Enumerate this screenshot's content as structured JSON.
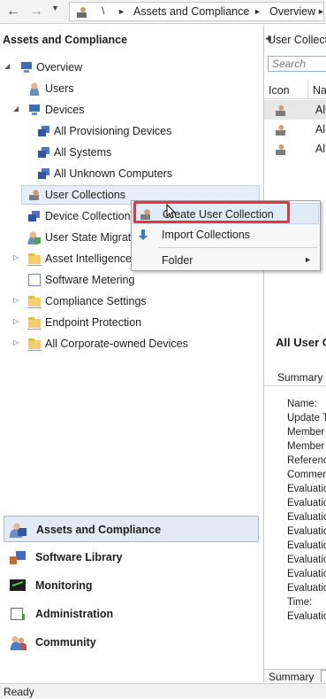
{
  "address_bar": {
    "back_icon": "back-arrow-icon",
    "forward_icon": "forward-arrow-icon",
    "root_sep": "\\",
    "crumb1": "Assets and Compliance",
    "crumb2": "Overview",
    "arrow": "►"
  },
  "left_pane": {
    "title": "Assets and Compliance",
    "tree": {
      "overview": "Overview",
      "users": "Users",
      "devices": "Devices",
      "all_provisioning": "All Provisioning Devices",
      "all_systems": "All Systems",
      "all_unknown": "All Unknown Computers",
      "user_collections": "User Collections",
      "device_collections": "Device Collections",
      "user_state": "User State Migration",
      "asset_intel": "Asset Intelligence",
      "software_metering": "Software Metering",
      "compliance_settings": "Compliance Settings",
      "endpoint_protection": "Endpoint Protection",
      "corporate_devices": "All Corporate-owned Devices"
    },
    "workspaces": {
      "assets": "Assets and Compliance",
      "software": "Software Library",
      "monitoring": "Monitoring",
      "administration": "Administration",
      "community": "Community"
    }
  },
  "right_pane": {
    "title": "User Collections",
    "search_placeholder": "Search",
    "col_icon": "Icon",
    "col_name": "Name",
    "rows": [
      "All",
      "All",
      "All"
    ],
    "details_title": "All User Collections",
    "details_tab": "Summary",
    "fields": [
      "Name:",
      "Update Time:",
      "Member",
      "Member",
      "Reference",
      "Comment",
      "Evaluation",
      "Evaluation",
      "Evaluation",
      "Evaluation",
      "Evaluation",
      "Evaluation",
      "Evaluation",
      "Evaluation",
      "Time:",
      "Evaluation"
    ],
    "bottom_tab": "Summary"
  },
  "context_menu": {
    "create": "Create User Collection",
    "import": "Import Collections",
    "folder": "Folder",
    "submenu_arrow": "►"
  },
  "status": "Ready",
  "colors": {
    "highlight_red": "#e0393e",
    "selection_blue": "#e5eef8"
  }
}
